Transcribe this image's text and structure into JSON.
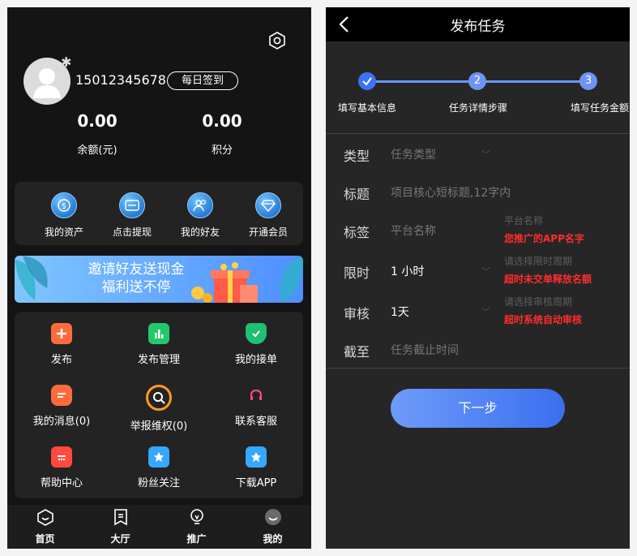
{
  "profile": {
    "phone": "15012345678",
    "checkin_label": "每日签到",
    "balance_value": "0.00",
    "balance_label": "余额(元)",
    "points_value": "0.00",
    "points_label": "积分"
  },
  "quick_actions": [
    {
      "label": "我的资产",
      "icon": "coin-icon"
    },
    {
      "label": "点击提现",
      "icon": "withdraw-card-icon"
    },
    {
      "label": "我的好友",
      "icon": "friends-icon"
    },
    {
      "label": "开通会员",
      "icon": "diamond-icon"
    }
  ],
  "banner": {
    "line1": "邀请好友送现金",
    "line2": "福利送不停"
  },
  "menu_grid": [
    {
      "label": "发布",
      "icon": "plus-icon",
      "color": "#ff6b3d"
    },
    {
      "label": "发布管理",
      "icon": "bar-chart-icon",
      "color": "#22c96b"
    },
    {
      "label": "我的接单",
      "icon": "shield-check-icon",
      "color": "#1fbf74"
    },
    {
      "label": "我的消息(0)",
      "icon": "message-icon",
      "color": "#ff6b3d"
    },
    {
      "label": "举报维权(0)",
      "icon": "search-report-icon",
      "color": "#ff9a1f"
    },
    {
      "label": "联系客服",
      "icon": "headset-icon",
      "color": "#ff4f7a"
    },
    {
      "label": "帮助中心",
      "icon": "calendar-help-icon",
      "color": "#ff4a3d"
    },
    {
      "label": "粉丝关注",
      "icon": "star-follow-icon",
      "color": "#35a8ff"
    },
    {
      "label": "下载APP",
      "icon": "download-app-icon",
      "color": "#35a8ff"
    }
  ],
  "tabbar": [
    {
      "label": "首页",
      "icon": "home-icon"
    },
    {
      "label": "大厅",
      "icon": "hall-icon"
    },
    {
      "label": "推广",
      "icon": "bulb-icon"
    },
    {
      "label": "我的",
      "icon": "profile-icon"
    }
  ],
  "publish": {
    "title": "发布任务",
    "steps": [
      {
        "num": "",
        "label": "填写基本信息"
      },
      {
        "num": "2",
        "label": "任务详情步骤"
      },
      {
        "num": "3",
        "label": "填写任务金额"
      }
    ],
    "fields": {
      "type": {
        "label": "类型",
        "placeholder": "任务类型"
      },
      "title": {
        "label": "标题",
        "placeholder": "项目核心短标题,12字内"
      },
      "tag": {
        "label": "标签",
        "placeholder": "平台名称",
        "hint": "平台名称",
        "hint_red": "您推广的APP名字"
      },
      "limit": {
        "label": "限时",
        "value": "1 小时",
        "hint": "请选择限时周期",
        "hint_red": "超时未交单释放名额"
      },
      "review": {
        "label": "审核",
        "value": "1天",
        "hint": "请选择审核周期",
        "hint_red": "超时系统自动审核"
      },
      "deadline": {
        "label": "截至",
        "placeholder": "任务截止时间"
      }
    },
    "next_label": "下一步"
  }
}
